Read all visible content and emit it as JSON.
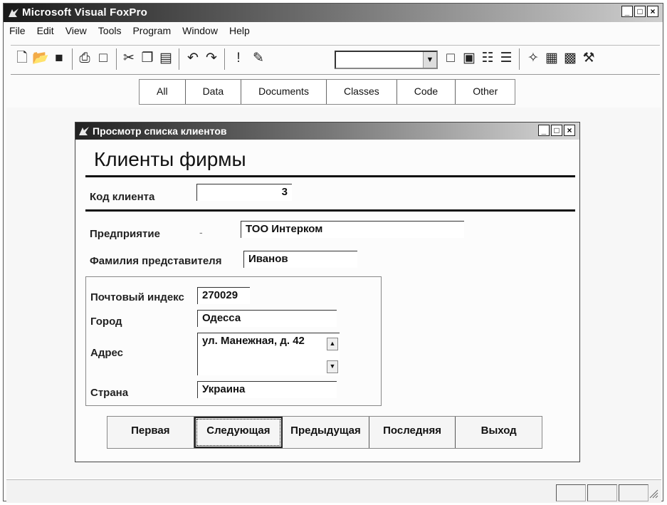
{
  "app": {
    "title": "Microsoft Visual FoxPro",
    "window_controls": [
      "_",
      "□",
      "×"
    ]
  },
  "menu": [
    "File",
    "Edit",
    "View",
    "Tools",
    "Program",
    "Window",
    "Help"
  ],
  "toolbar": {
    "icons": [
      "new-file-icon",
      "open-folder-icon",
      "save-icon",
      "print-icon",
      "print-preview-icon",
      "cut-icon",
      "copy-icon",
      "paste-icon",
      "undo-icon",
      "redo-icon",
      "run-icon",
      "modify-form-icon",
      "combo",
      "form-control-icon",
      "window-icon",
      "properties-icon",
      "report-icon",
      "wizard-icon",
      "builder-icon",
      "database-icon",
      "tools-icon"
    ],
    "combo_value": ""
  },
  "tabs": [
    "All",
    "Data",
    "Documents",
    "Classes",
    "Code",
    "Other"
  ],
  "form": {
    "title": "Просмотр списка клиентов",
    "heading": "Клиенты фирмы",
    "client_code": {
      "label": "Код клиента",
      "value": "3"
    },
    "company": {
      "label": "Предприятие",
      "value": "ТОО Интерком"
    },
    "contact": {
      "label": "Фамилия представителя",
      "value": "Иванов"
    },
    "postal": {
      "label": "Почтовый индекс",
      "value": "270029"
    },
    "city": {
      "label": "Город",
      "value": "Одесса"
    },
    "address": {
      "label": "Адрес",
      "value": "ул. Манежная, д. 42"
    },
    "country": {
      "label": "Страна",
      "value": "Украина"
    },
    "buttons": [
      "Первая",
      "Следующая",
      "Предыдущая",
      "Последняя",
      "Выход"
    ]
  }
}
